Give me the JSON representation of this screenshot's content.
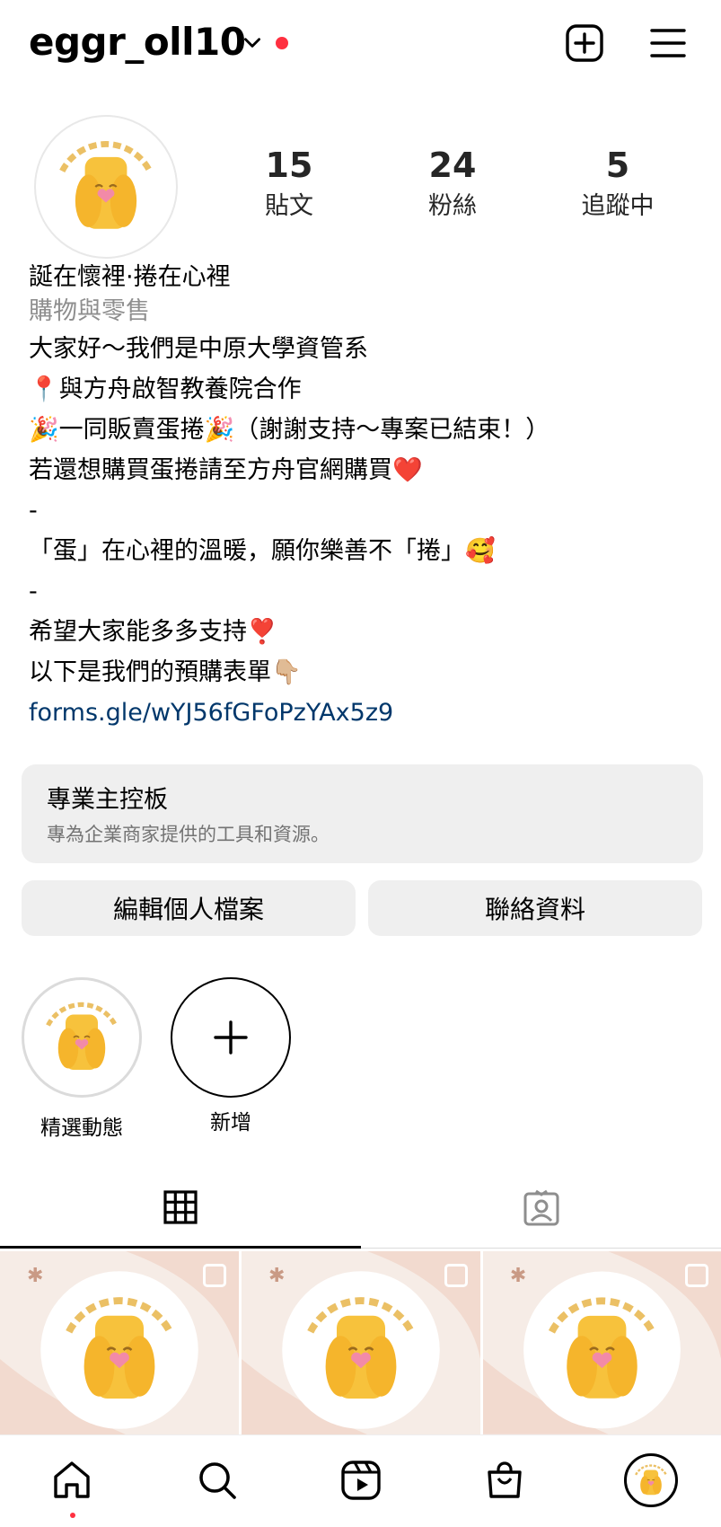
{
  "header": {
    "username": "eggr_oll10",
    "notification_color": "#ff3040",
    "add_icon": "plus-square-icon",
    "menu_icon": "hamburger-menu-icon"
  },
  "profile": {
    "avatar_icon": "egg-roll-logo-icon",
    "stats": [
      {
        "value": "15",
        "label": "貼文"
      },
      {
        "value": "24",
        "label": "粉絲"
      },
      {
        "value": "5",
        "label": "追蹤中"
      }
    ],
    "name": "誕在懷裡·捲在心裡",
    "category": "購物與零售",
    "bio_lines": [
      "大家好～我們是中原大學資管系",
      "📍與方舟啟智教養院合作",
      "🎉一同販賣蛋捲🎉（謝謝支持～專案已結束！）",
      "若還想購買蛋捲請至方舟官網購買❤️",
      "-",
      "「蛋」在心裡的溫暖，願你樂善不「捲」🥰",
      "-",
      "希望大家能多多支持❣️",
      "以下是我們的預購表單👇🏼"
    ],
    "link": "forms.gle/wYJ56fGFoPzYAx5z9"
  },
  "dashboard": {
    "title": "專業主控板",
    "subtitle": "專為企業商家提供的工具和資源。"
  },
  "buttons": {
    "edit_profile": "編輯個人檔案",
    "contact": "聯絡資料"
  },
  "highlights": [
    {
      "label": "精選動態",
      "icon": "egg-roll-logo-icon"
    },
    {
      "label": "新增",
      "icon": "plus-icon"
    }
  ],
  "tabs": [
    {
      "name": "posts-grid",
      "icon": "grid-icon",
      "active": true
    },
    {
      "name": "tagged",
      "icon": "tagged-person-icon",
      "active": false
    }
  ],
  "posts": [
    {
      "icon": "egg-roll-logo-icon",
      "multi": true
    },
    {
      "icon": "egg-roll-logo-icon",
      "multi": true
    },
    {
      "icon": "egg-roll-logo-icon",
      "multi": true
    }
  ],
  "bottom_nav": [
    {
      "name": "home",
      "icon": "home-icon",
      "active": true
    },
    {
      "name": "search",
      "icon": "search-icon"
    },
    {
      "name": "reels",
      "icon": "reels-icon"
    },
    {
      "name": "shop",
      "icon": "shopping-bag-icon"
    },
    {
      "name": "profile",
      "icon": "avatar-icon"
    }
  ],
  "colors": {
    "link": "#00376b",
    "muted": "#8e8e8e",
    "card_bg": "#efefef",
    "logo_yellow": "#f7c23c",
    "logo_pink": "#f28aa8",
    "post_bg": "#f6ece6"
  }
}
